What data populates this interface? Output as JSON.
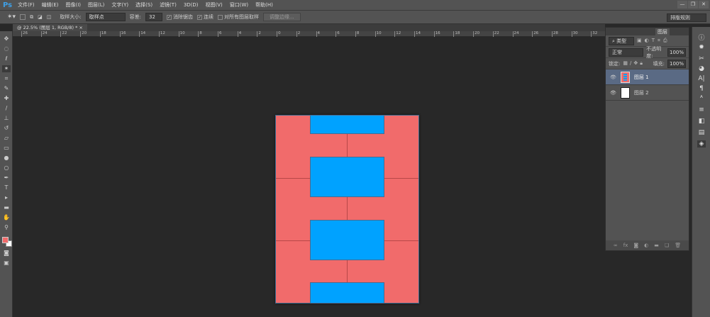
{
  "app": {
    "logo": "Ps"
  },
  "menu": [
    "文件(F)",
    "编辑(E)",
    "图像(I)",
    "图层(L)",
    "文字(Y)",
    "选择(S)",
    "滤镜(T)",
    "3D(D)",
    "视图(V)",
    "窗口(W)",
    "帮助(H)"
  ],
  "window_buttons": [
    "—",
    "❐",
    "✕"
  ],
  "options": {
    "sample_size_label": "取样大小:",
    "sample_size_value": "取样点",
    "tolerance_label": "容差:",
    "tolerance_value": "32",
    "antialias_label": "消除锯齿",
    "antialias_checked": true,
    "contiguous_label": "连续",
    "contiguous_checked": true,
    "all_layers_label": "对所有图层取样",
    "all_layers_checked": false,
    "refine_edge": "调整边缘...",
    "workspace": "排版规则"
  },
  "document_tab": {
    "title": "@ 22.5% (图层 1, RGB/8) *",
    "close": "×"
  },
  "ruler": [
    "26",
    "24",
    "22",
    "20",
    "18",
    "16",
    "14",
    "12",
    "10",
    "8",
    "6",
    "4",
    "2",
    "0",
    "2",
    "4",
    "6",
    "8",
    "10",
    "12",
    "14",
    "16",
    "18",
    "20",
    "22",
    "24",
    "26",
    "28",
    "30",
    "32"
  ],
  "canvas": {
    "background": "#f16b6b",
    "accent": "#00a2ff"
  },
  "layers_panel": {
    "tab": "图层",
    "filter": "类型",
    "blend_mode": "正常",
    "opacity_label": "不透明度:",
    "opacity": "100%",
    "lock_label": "锁定:",
    "fill_label": "填充:",
    "fill": "100%",
    "layers": [
      {
        "name": "图层 1",
        "selected": true
      },
      {
        "name": "图层 2",
        "selected": false
      }
    ]
  },
  "colors": {
    "foreground": "#f16b6b",
    "background": "#ffffff"
  }
}
